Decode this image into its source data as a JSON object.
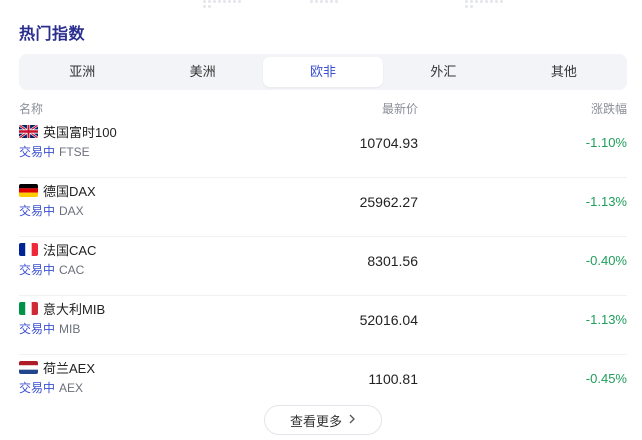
{
  "section": {
    "title": "热门指数"
  },
  "tabs": [
    {
      "label": "亚洲",
      "active": false
    },
    {
      "label": "美洲",
      "active": false
    },
    {
      "label": "欧非",
      "active": true
    },
    {
      "label": "外汇",
      "active": false
    },
    {
      "label": "其他",
      "active": false
    }
  ],
  "table": {
    "headers": {
      "name": "名称",
      "price": "最新价",
      "change": "涨跌幅"
    },
    "rows": [
      {
        "flag": "uk-flag-icon",
        "name": "英国富时100",
        "status": "交易中",
        "code": "FTSE",
        "price": "10704.93",
        "change": "-1.10%"
      },
      {
        "flag": "germany-flag-icon",
        "name": "德国DAX",
        "status": "交易中",
        "code": "DAX",
        "price": "25962.27",
        "change": "-1.13%"
      },
      {
        "flag": "france-flag-icon",
        "name": "法国CAC",
        "status": "交易中",
        "code": "CAC",
        "price": "8301.56",
        "change": "-0.40%"
      },
      {
        "flag": "italy-flag-icon",
        "name": "意大利MIB",
        "status": "交易中",
        "code": "MIB",
        "price": "52016.04",
        "change": "-1.13%"
      },
      {
        "flag": "netherlands-flag-icon",
        "name": "荷兰AEX",
        "status": "交易中",
        "code": "AEX",
        "price": "1100.81",
        "change": "-0.45%"
      }
    ]
  },
  "more_button": {
    "label": "查看更多"
  },
  "colors": {
    "title": "#2a2f8f",
    "accent": "#3a4fd1",
    "down": "#1e9e5a",
    "tab_bg": "#f3f4f7"
  }
}
